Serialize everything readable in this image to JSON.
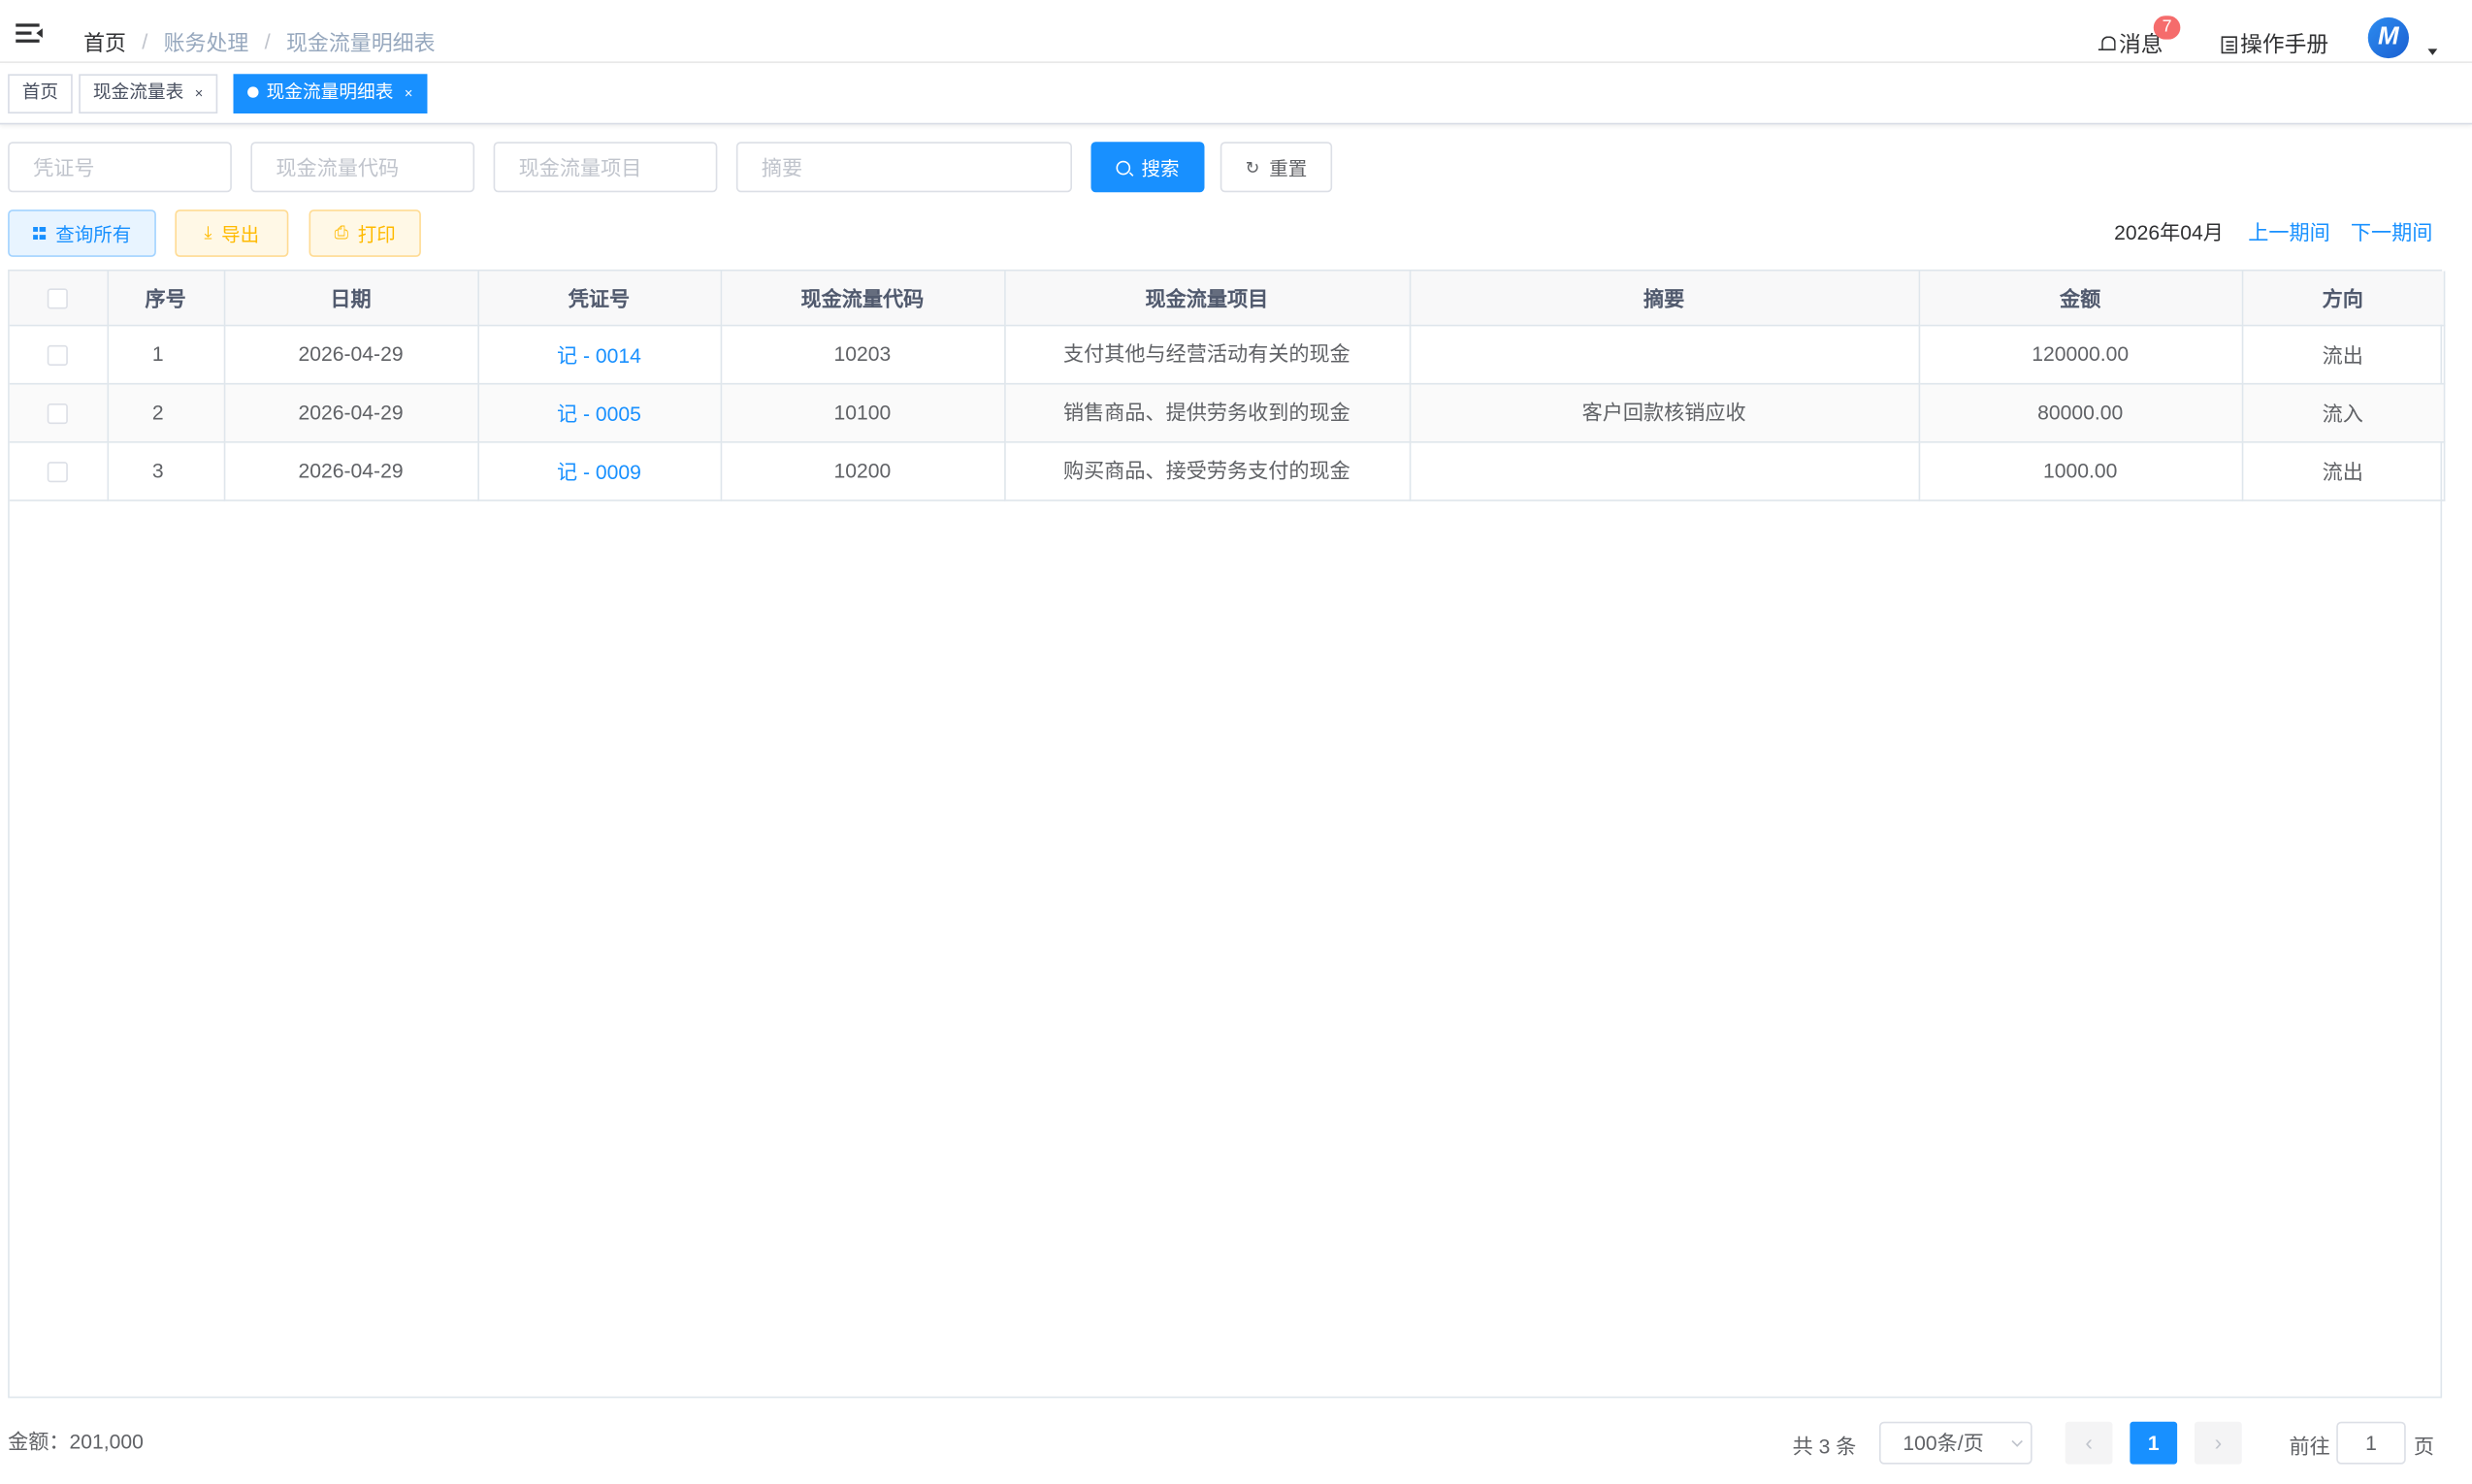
{
  "navbar": {
    "breadcrumb": [
      "首页",
      "账务处理",
      "现金流量明细表"
    ],
    "breadcrumb_sep": "/",
    "messages_label": "消息",
    "messages_badge": "7",
    "manual_label": "操作手册",
    "avatar_letter": "M"
  },
  "tags": [
    {
      "label": "首页"
    },
    {
      "label": "现金流量表",
      "close": "×"
    },
    {
      "label": "现金流量明细表",
      "close": "×",
      "active": true
    }
  ],
  "search": {
    "voucher_placeholder": "凭证号",
    "code_placeholder": "现金流量代码",
    "item_placeholder": "现金流量项目",
    "summary_placeholder": "摘要",
    "search_label": "搜索",
    "reset_label": "重置"
  },
  "toolbar": {
    "query_all_label": "查询所有",
    "export_label": "导出",
    "print_label": "打印",
    "period": "2026年04月",
    "prev_period": "上一期间",
    "next_period": "下一期间"
  },
  "table": {
    "columns": [
      "序号",
      "日期",
      "凭证号",
      "现金流量代码",
      "现金流量项目",
      "摘要",
      "金额",
      "方向"
    ],
    "rows": [
      {
        "index": "1",
        "date": "2026-04-29",
        "voucher": "记 - 0014",
        "code": "10203",
        "item": "支付其他与经营活动有关的现金",
        "summary": "",
        "amount": "120000.00",
        "direction": "流出"
      },
      {
        "index": "2",
        "date": "2026-04-29",
        "voucher": "记 - 0005",
        "code": "10100",
        "item": "销售商品、提供劳务收到的现金",
        "summary": "客户回款核销应收",
        "amount": "80000.00",
        "direction": "流入"
      },
      {
        "index": "3",
        "date": "2026-04-29",
        "voucher": "记 - 0009",
        "code": "10200",
        "item": "购买商品、接受劳务支付的现金",
        "summary": "",
        "amount": "1000.00",
        "direction": "流出"
      }
    ]
  },
  "footer": {
    "total_label": "金额：201,000",
    "pager_total": "共 3 条",
    "page_size": "100条/页",
    "current_page": "1",
    "goto_prefix": "前往",
    "goto_value": "1",
    "goto_suffix": "页"
  },
  "colors": {
    "primary": "#1890ff",
    "badge": "#f56c6c",
    "warning": "#ffba00"
  }
}
